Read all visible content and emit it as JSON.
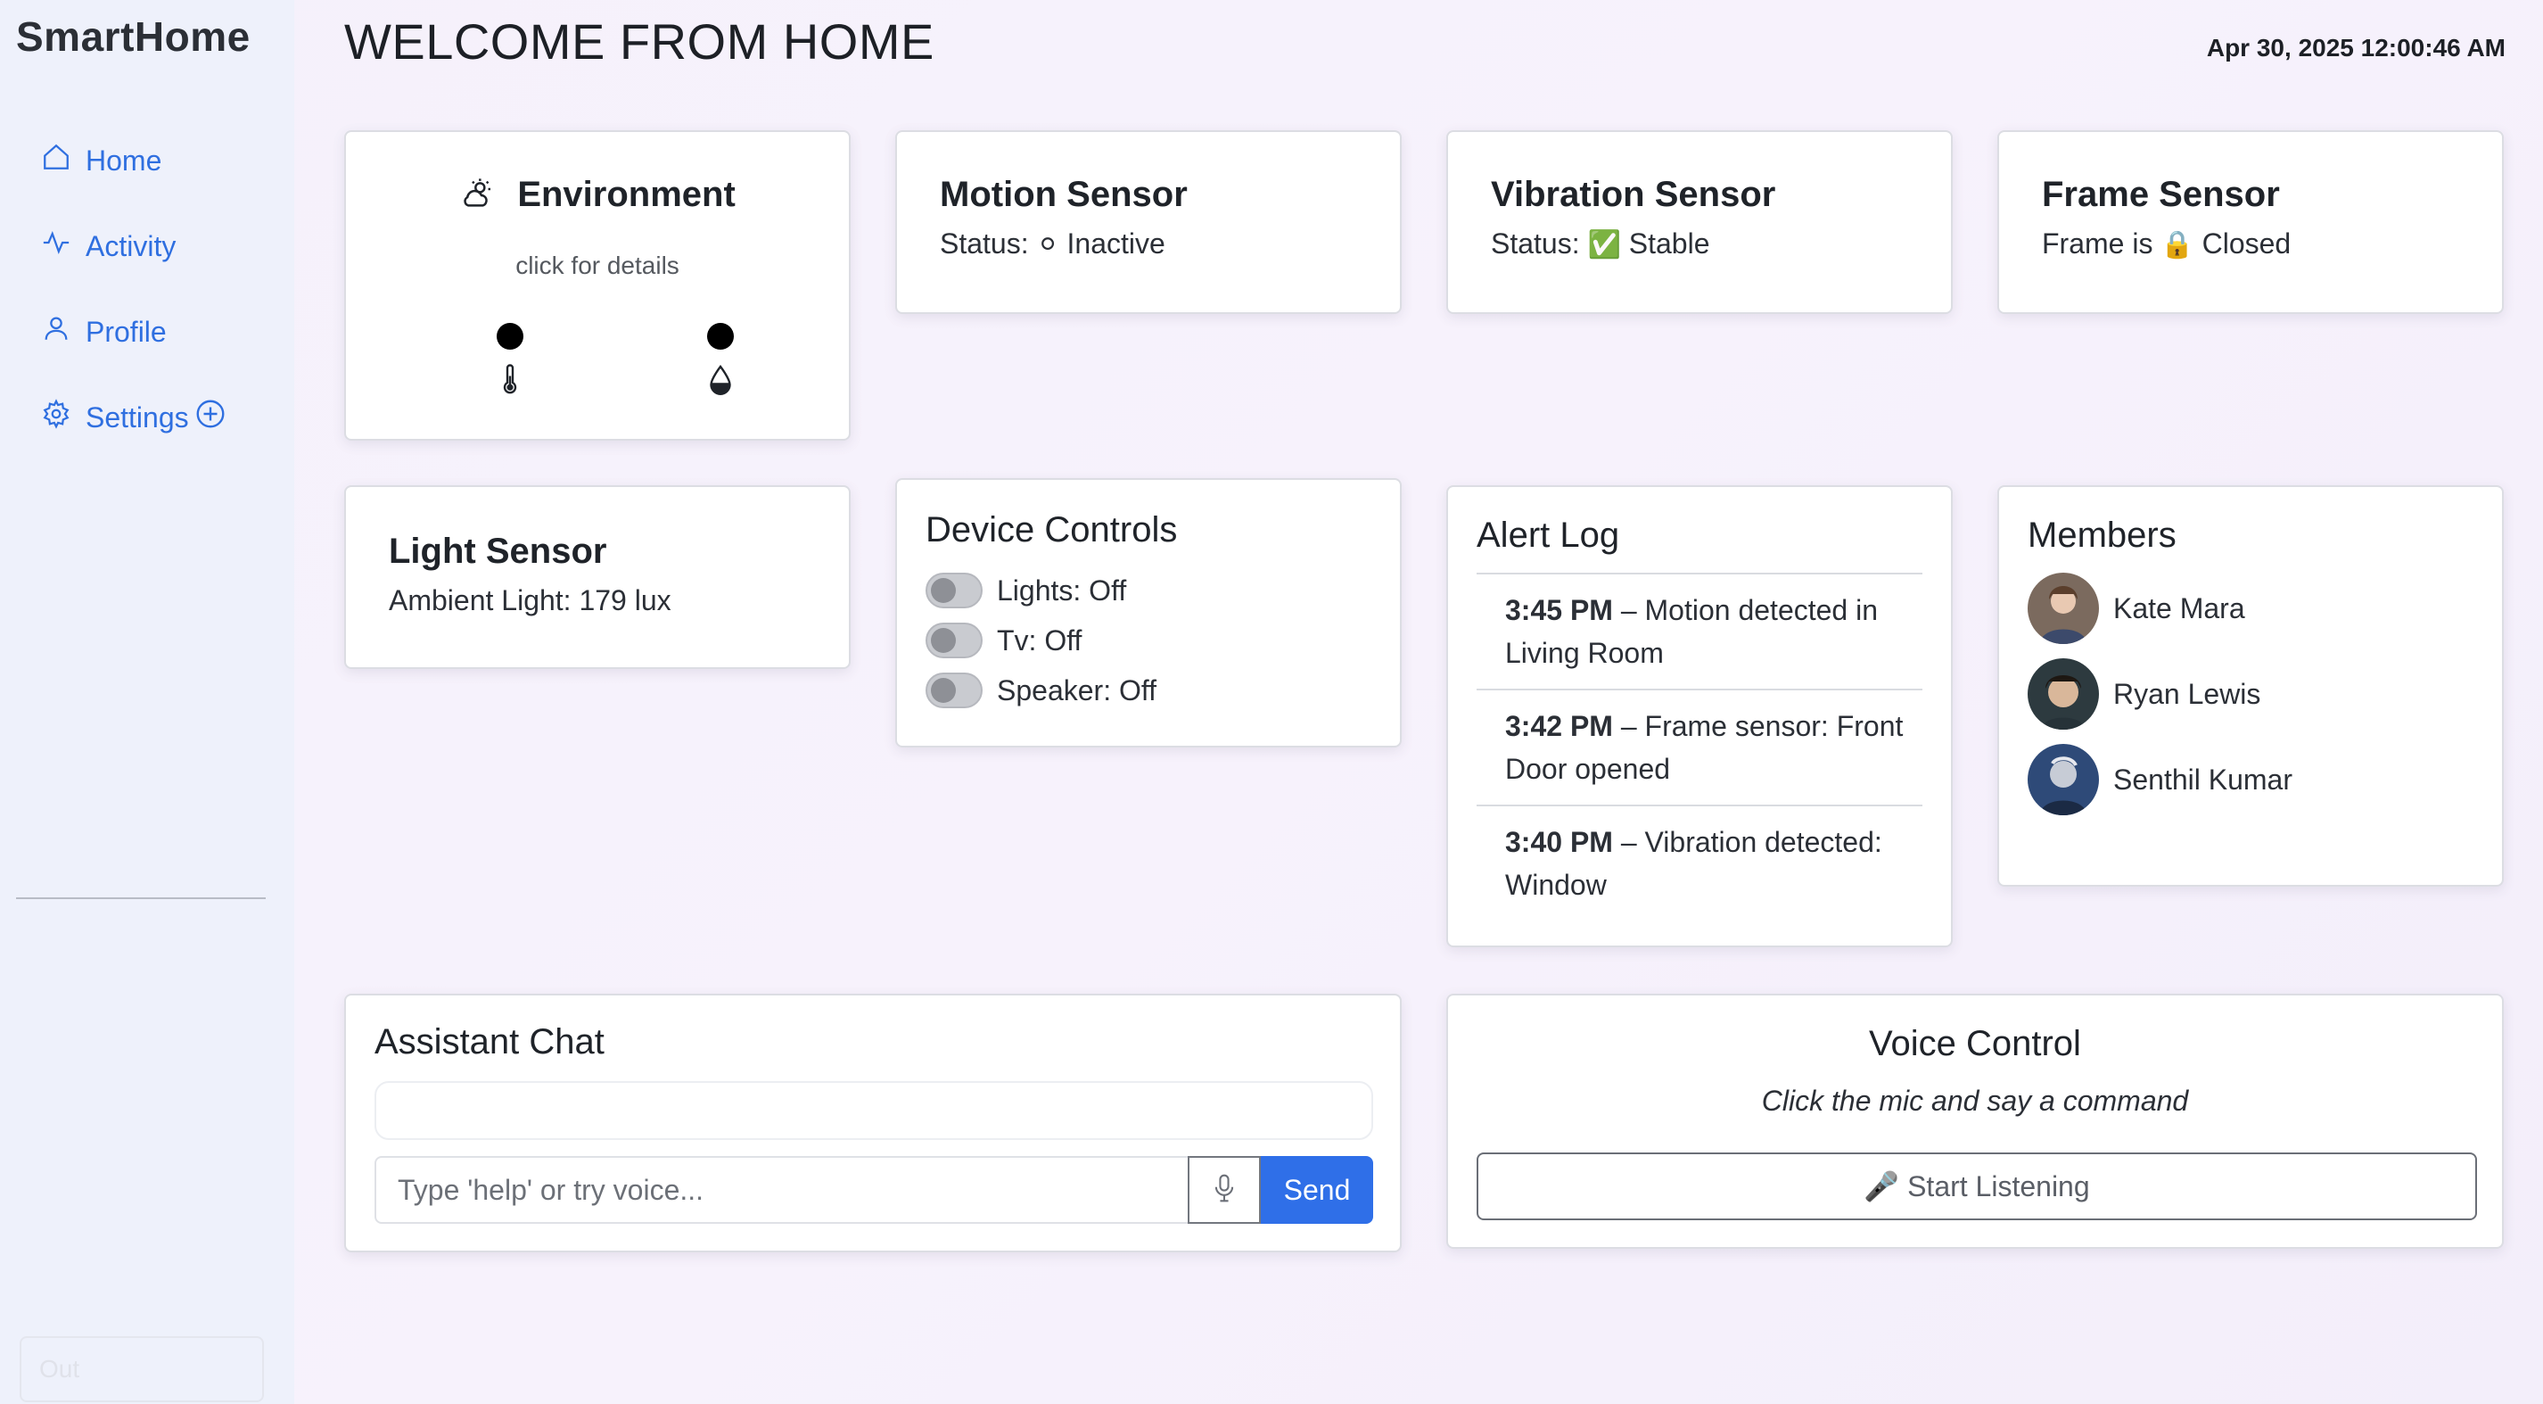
{
  "app": {
    "brand": "SmartHome",
    "page_title": "WELCOME FROM HOME",
    "timestamp": "Apr 30, 2025 12:00:46 AM"
  },
  "sidebar": {
    "items": [
      {
        "label": "Home",
        "icon": "home-icon"
      },
      {
        "label": "Activity",
        "icon": "activity-icon"
      },
      {
        "label": "Profile",
        "icon": "user-icon"
      },
      {
        "label": "Settings",
        "icon": "gear-icon"
      }
    ],
    "logout_label": "Out"
  },
  "environment": {
    "title": "Environment",
    "hint": "click for details",
    "icon": "cloud-sun-icon",
    "stats": [
      {
        "icon": "thermometer-icon"
      },
      {
        "icon": "droplet-icon"
      }
    ]
  },
  "motion": {
    "title": "Motion Sensor",
    "status_label": "Status:",
    "status_icon": "⚪",
    "status_value": "Inactive"
  },
  "vibration": {
    "title": "Vibration Sensor",
    "status_label": "Status:",
    "status_icon": "✅",
    "status_value": "Stable"
  },
  "frame": {
    "title": "Frame Sensor",
    "status_label": "Frame is",
    "status_icon": "🔒",
    "status_value": "Closed"
  },
  "light": {
    "title": "Light Sensor",
    "reading": "Ambient Light: 179 lux"
  },
  "devices": {
    "title": "Device Controls",
    "items": [
      {
        "label": "Lights: Off",
        "on": false
      },
      {
        "label": "Tv: Off",
        "on": false
      },
      {
        "label": "Speaker: Off",
        "on": false
      }
    ]
  },
  "alerts": {
    "title": "Alert Log",
    "items": [
      {
        "time": "3:45 PM",
        "text": " – Motion detected in Living Room"
      },
      {
        "time": "3:42 PM",
        "text": " – Frame sensor: Front Door opened"
      },
      {
        "time": "3:40 PM",
        "text": " – Vibration detected: Window"
      }
    ]
  },
  "members": {
    "title": "Members",
    "items": [
      {
        "name": "Kate Mara"
      },
      {
        "name": "Ryan Lewis"
      },
      {
        "name": "Senthil Kumar"
      }
    ]
  },
  "chat": {
    "title": "Assistant Chat",
    "placeholder": "Type 'help' or try voice...",
    "send_label": "Send"
  },
  "voice": {
    "title": "Voice Control",
    "hint": "Click the mic and say a command",
    "button_label": "🎤 Start Listening"
  },
  "colors": {
    "accent": "#2f6fe8",
    "nav_link": "#2f6fe0",
    "sidebar_bg": "#eef1fb"
  }
}
